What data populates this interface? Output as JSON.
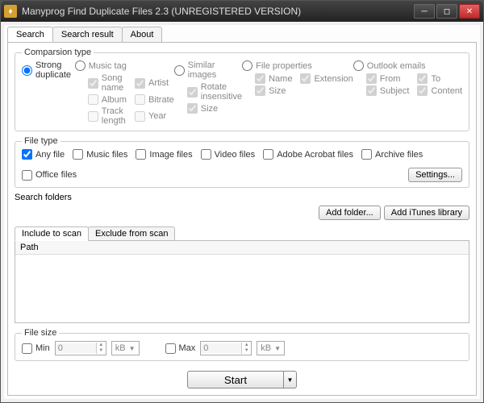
{
  "window": {
    "title": "Manyprog Find Duplicate Files 2.3 (UNREGISTERED VERSION)"
  },
  "tabs": {
    "search": "Search",
    "search_result": "Search result",
    "about": "About"
  },
  "comparison": {
    "legend": "Comparsion type",
    "strong": "Strong duplicate",
    "music": "Music tag",
    "music_opts": {
      "song_name": "Song name",
      "artist": "Artist",
      "album": "Album",
      "bitrate": "Bitrate",
      "track_length": "Track length",
      "year": "Year"
    },
    "similar": "Similar images",
    "similar_opts": {
      "rotate": "Rotate insensitive",
      "size": "Size"
    },
    "fileprops": "File properties",
    "fileprops_opts": {
      "name": "Name",
      "extension": "Extension",
      "size": "Size"
    },
    "outlook": "Outlook emails",
    "outlook_opts": {
      "from": "From",
      "to": "To",
      "subject": "Subject",
      "content": "Content"
    }
  },
  "filetype": {
    "legend": "File type",
    "any": "Any file",
    "music": "Music files",
    "image": "Image files",
    "video": "Video files",
    "acrobat": "Adobe Acrobat files",
    "archive": "Archive files",
    "office": "Office files",
    "settings": "Settings..."
  },
  "folders": {
    "label": "Search folders",
    "add_folder": "Add folder...",
    "add_itunes": "Add iTunes library",
    "include_tab": "Include to scan",
    "exclude_tab": "Exclude from scan",
    "path_header": "Path"
  },
  "filesize": {
    "legend": "File size",
    "min": "Min",
    "max": "Max",
    "min_val": "0",
    "max_val": "0",
    "unit": "kB"
  },
  "start": "Start"
}
